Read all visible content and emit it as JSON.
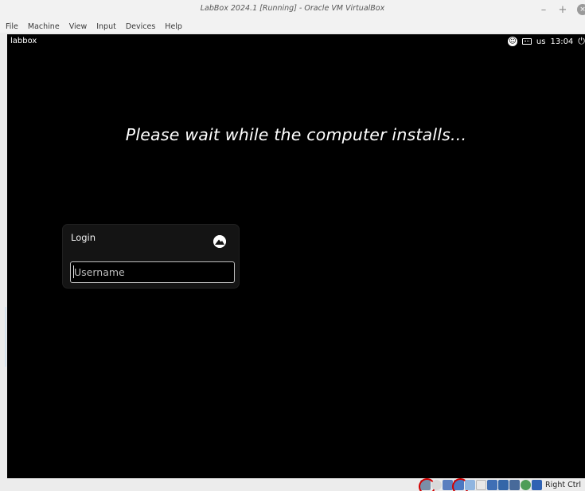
{
  "window": {
    "title": "LabBox 2024.1 [Running] - Oracle VM VirtualBox",
    "controls": {
      "minimize": "–",
      "maximize": "+",
      "close": "×"
    }
  },
  "menubar": {
    "items": [
      "File",
      "Machine",
      "View",
      "Input",
      "Devices",
      "Help"
    ]
  },
  "guest_topbar": {
    "hostname": "labbox",
    "keyboard_layout": "us",
    "clock": "13:04",
    "icons": [
      "accessibility-icon",
      "keyboard-icon",
      "power-icon"
    ]
  },
  "guest_screen": {
    "headline": "Please wait while the computer installs...",
    "login": {
      "title": "Login",
      "logo_icon": "distro-logo-icon",
      "username_placeholder": "Username",
      "username_value": ""
    }
  },
  "statusbar": {
    "icons": [
      "hard-disk-icon",
      "optical-drive-icon",
      "audio-icon",
      "network-icon",
      "usb-icon",
      "shared-folders-icon",
      "display-icon",
      "recording-icon",
      "cpu-icon",
      "mouse-integration-icon",
      "host-key-arrow-icon"
    ],
    "highlighted": [
      "hard-disk-icon",
      "network-icon"
    ],
    "host_key": "Right Ctrl"
  }
}
